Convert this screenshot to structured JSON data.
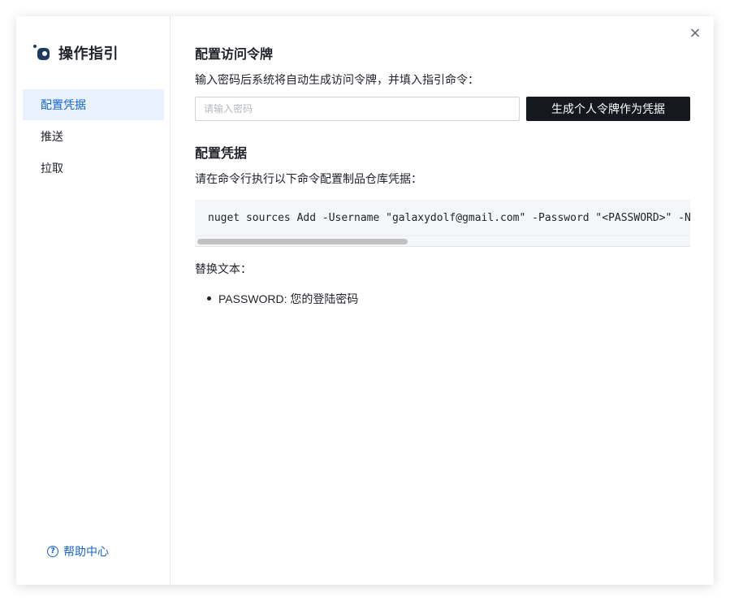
{
  "sidebar": {
    "brand_title": "操作指引",
    "items": [
      {
        "label": "配置凭据",
        "active": true
      },
      {
        "label": "推送",
        "active": false
      },
      {
        "label": "拉取",
        "active": false
      }
    ],
    "help_label": "帮助中心",
    "help_icon": "question-circle-icon"
  },
  "header": {
    "close_icon": "close-icon",
    "close_glyph": "×"
  },
  "token_section": {
    "title": "配置访问令牌",
    "description": "输入密码后系统将自动生成访问令牌，并填入指引命令：",
    "password_placeholder": "请输入密码",
    "password_value": "",
    "generate_label": "生成个人令牌作为凭据"
  },
  "credential_section": {
    "title": "配置凭据",
    "description": "请在命令行执行以下命令配置制品仓库凭据：",
    "command": "nuget sources Add -Username \"galaxydolf@gmail.com\" -Password \"<PASSWORD>\" -N",
    "replace_title": "替换文本：",
    "replacements": [
      {
        "text": "PASSWORD: 您的登陆密码"
      }
    ]
  },
  "colors": {
    "accent": "#1664d3",
    "active_bg": "#e8f1fd",
    "button_bg": "#15191f",
    "logo": "#1e3a5f"
  }
}
